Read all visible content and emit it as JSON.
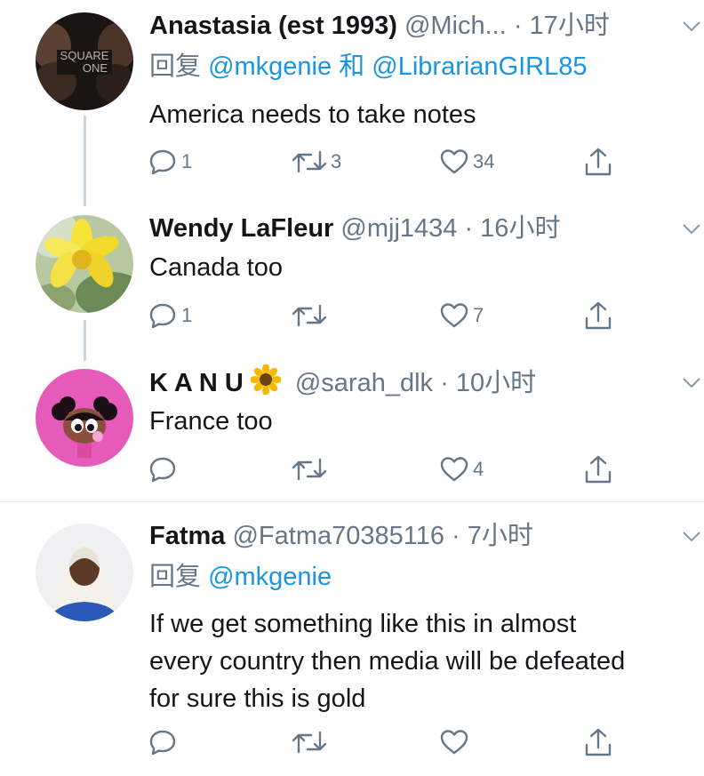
{
  "tweets": [
    {
      "name": "Anastasia (est 1993)",
      "handle": "@Mich...",
      "time": "· 17小时",
      "reply_prefix": "回复",
      "mention1": "@mkgenie",
      "reply_and": "和",
      "mention2": "@LibrarianGIRL85",
      "text": "America needs to take notes",
      "avatar_text1": "SQUARE",
      "avatar_text2": "ONE",
      "reply_count": "1",
      "retweet_count": "3",
      "like_count": "34"
    },
    {
      "name": "Wendy LaFleur",
      "handle": "@mjj1434",
      "time": "· 16小时",
      "text": "Canada too",
      "reply_count": "1",
      "retweet_count": "",
      "like_count": "7"
    },
    {
      "name": "K A N U",
      "name_emoji": "sunflower-icon",
      "handle": "@sarah_dlk",
      "time": "· 10小时",
      "text": "France too",
      "reply_count": "",
      "retweet_count": "",
      "like_count": "4"
    },
    {
      "name": "Fatma",
      "handle": "@Fatma70385116",
      "time": "· 7小时",
      "reply_prefix": "回复",
      "mention1": "@mkgenie",
      "text_line1": "If we get something like this in almost",
      "text_line2": "every country then media will be defeated",
      "text_line3": "for sure this is gold",
      "reply_count": "",
      "retweet_count": "",
      "like_count": ""
    }
  ],
  "colors": {
    "accent": "#1b95e0",
    "secondary_text": "#657786",
    "thread_line": "#ccd6dd",
    "divider": "#e6ecf0"
  }
}
